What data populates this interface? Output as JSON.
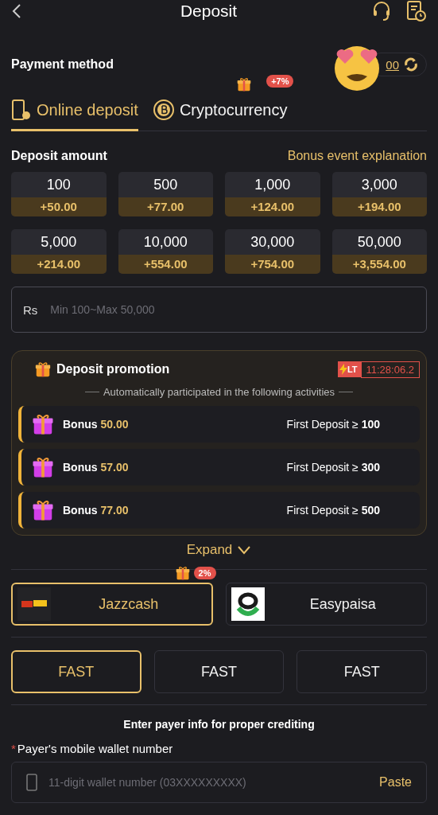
{
  "header": {
    "title": "Deposit"
  },
  "payment_method": {
    "label": "Payment method",
    "balance": "00"
  },
  "tabs": [
    {
      "label": "Online deposit",
      "selected": true,
      "kind": "online"
    },
    {
      "label": "Cryptocurrency",
      "selected": false,
      "kind": "crypto",
      "badge": "+7%"
    }
  ],
  "amount": {
    "label": "Deposit amount",
    "link": "Bonus event explanation",
    "currency": "Rs",
    "placeholder": "Min 100~Max 50,000",
    "options": [
      {
        "amount": "100",
        "bonus": "+50.00"
      },
      {
        "amount": "500",
        "bonus": "+77.00"
      },
      {
        "amount": "1,000",
        "bonus": "+124.00"
      },
      {
        "amount": "3,000",
        "bonus": "+194.00"
      },
      {
        "amount": "5,000",
        "bonus": "+214.00"
      },
      {
        "amount": "10,000",
        "bonus": "+554.00"
      },
      {
        "amount": "30,000",
        "bonus": "+754.00"
      },
      {
        "amount": "50,000",
        "bonus": "+3,554.00"
      }
    ]
  },
  "promotion": {
    "title": "Deposit promotion",
    "tag": "LT",
    "timer": "11:28:06.2",
    "subtitle": "Automatically participated in the following activities",
    "expand": "Expand",
    "items": [
      {
        "label": "Bonus",
        "amount": "50.00",
        "condition": "First Deposit ≥ **100**"
      },
      {
        "label": "Bonus",
        "amount": "57.00",
        "condition": "First Deposit ≥ **300**"
      },
      {
        "label": "Bonus",
        "amount": "77.00",
        "condition": "First Deposit ≥ **500**"
      }
    ]
  },
  "wallets": [
    {
      "name": "Jazzcash",
      "selected": true,
      "kind": "jazzcash",
      "badge": "2%"
    },
    {
      "name": "Easypaisa",
      "selected": false,
      "kind": "easypaisa"
    }
  ],
  "channels": [
    {
      "label": "FAST",
      "selected": true
    },
    {
      "label": "FAST",
      "selected": false
    },
    {
      "label": "FAST",
      "selected": false
    }
  ],
  "payer": {
    "heading": "Enter payer info for proper crediting",
    "required_mark": "*",
    "label": "Payer's mobile wallet number",
    "placeholder": "11-digit wallet number (03XXXXXXXXX)",
    "paste": "Paste"
  }
}
